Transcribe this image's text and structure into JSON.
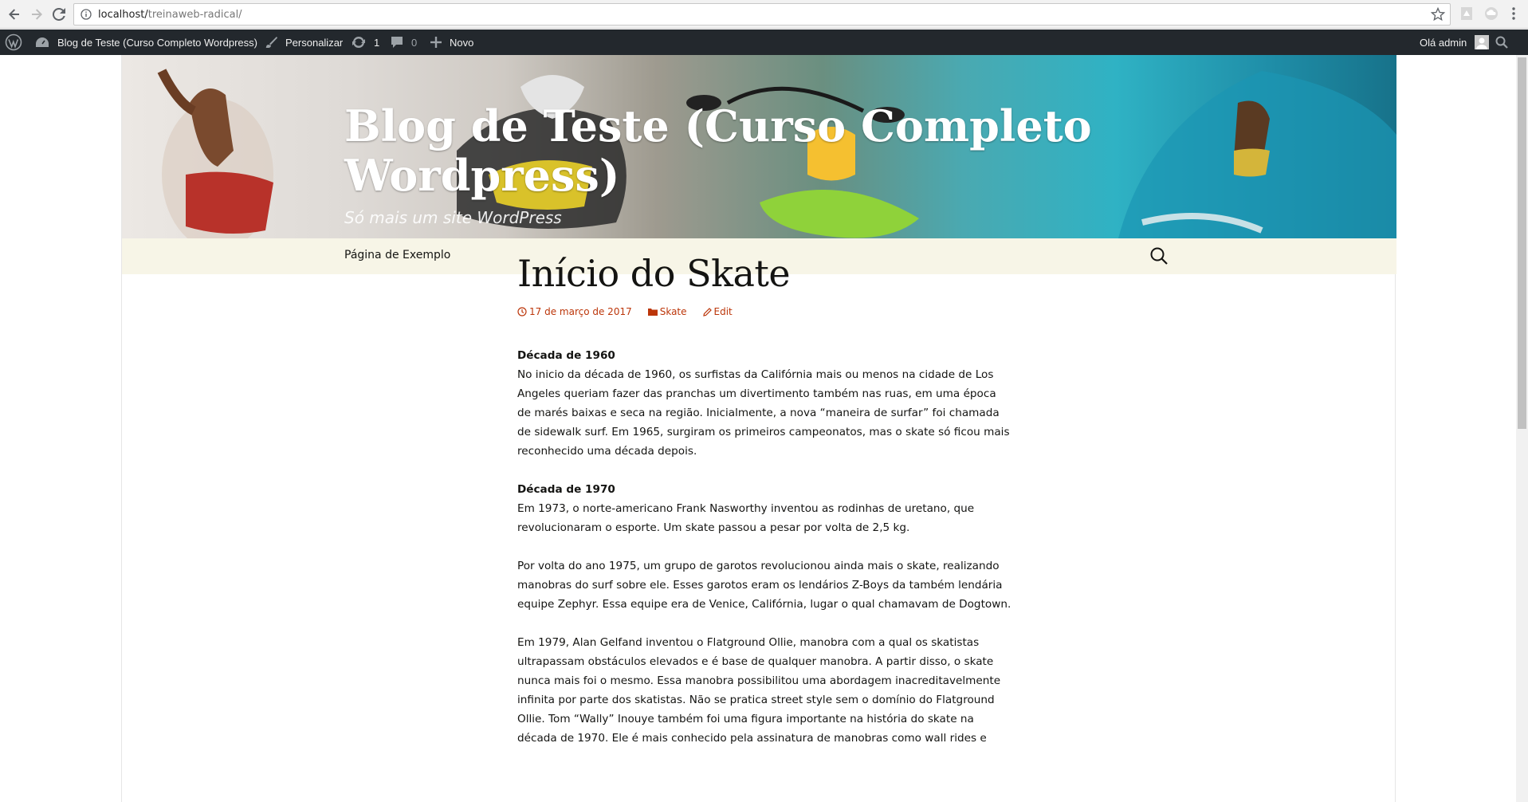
{
  "browser": {
    "url_host": "localhost/",
    "url_path": "treinaweb-radical/",
    "back_icon": "arrow-left-icon",
    "forward_icon": "arrow-right-icon",
    "reload_icon": "reload-icon",
    "bookmark_icon": "star-icon"
  },
  "adminbar": {
    "site_name": "Blog de Teste (Curso Completo Wordpress)",
    "customize": "Personalizar",
    "updates": "1",
    "comments": "0",
    "new": "Novo",
    "greeting": "Olá admin"
  },
  "site": {
    "title": "Blog de Teste (Curso Completo Wordpress)",
    "description": "Só mais um site WordPress",
    "menu_item": "Página de Exemplo"
  },
  "post": {
    "title": "Início do Skate",
    "date": "17 de março de 2017",
    "category": "Skate",
    "edit": "Edit",
    "sections": [
      {
        "heading": "Década de 1960",
        "text": "No inicio da década de 1960, os surfistas da Califórnia mais ou menos na cidade de Los Angeles queriam fazer das pranchas um divertimento também nas ruas, em uma época de marés baixas e seca na região. Inicialmente, a nova “maneira de surfar” foi chamada de sidewalk surf. Em 1965, surgiram os primeiros campeonatos, mas o skate só ficou mais reconhecido uma década depois."
      },
      {
        "heading": "Década de 1970",
        "text": "Em 1973, o norte-americano Frank Nasworthy inventou as rodinhas de uretano, que revolucionaram o esporte. Um skate passou a pesar por volta de 2,5 kg."
      }
    ],
    "paragraphs": [
      "Por volta do ano 1975, um grupo de garotos revolucionou ainda mais o skate, realizando manobras do surf sobre ele. Esses garotos eram os lendários Z-Boys da também lendária equipe Zephyr. Essa equipe era de Venice, Califórnia, lugar o qual chamavam de Dogtown.",
      "Em 1979, Alan Gelfand inventou o Flatground Ollie, manobra com a qual os skatistas ultrapassam obstáculos elevados e é base de qualquer manobra. A partir disso, o skate nunca mais foi o mesmo. Essa manobra possibilitou uma abordagem inacreditavelmente infinita por parte dos skatistas. Não se pratica street style sem o domínio do Flatground Ollie. Tom “Wally” Inouye também foi uma figura importante na história do skate na década de 1970. Ele é mais conhecido pela assinatura de manobras como wall rides e"
    ]
  },
  "colors": {
    "accent": "#bc360a",
    "adminbar": "#23282d",
    "navbar": "#f7f5e7"
  }
}
